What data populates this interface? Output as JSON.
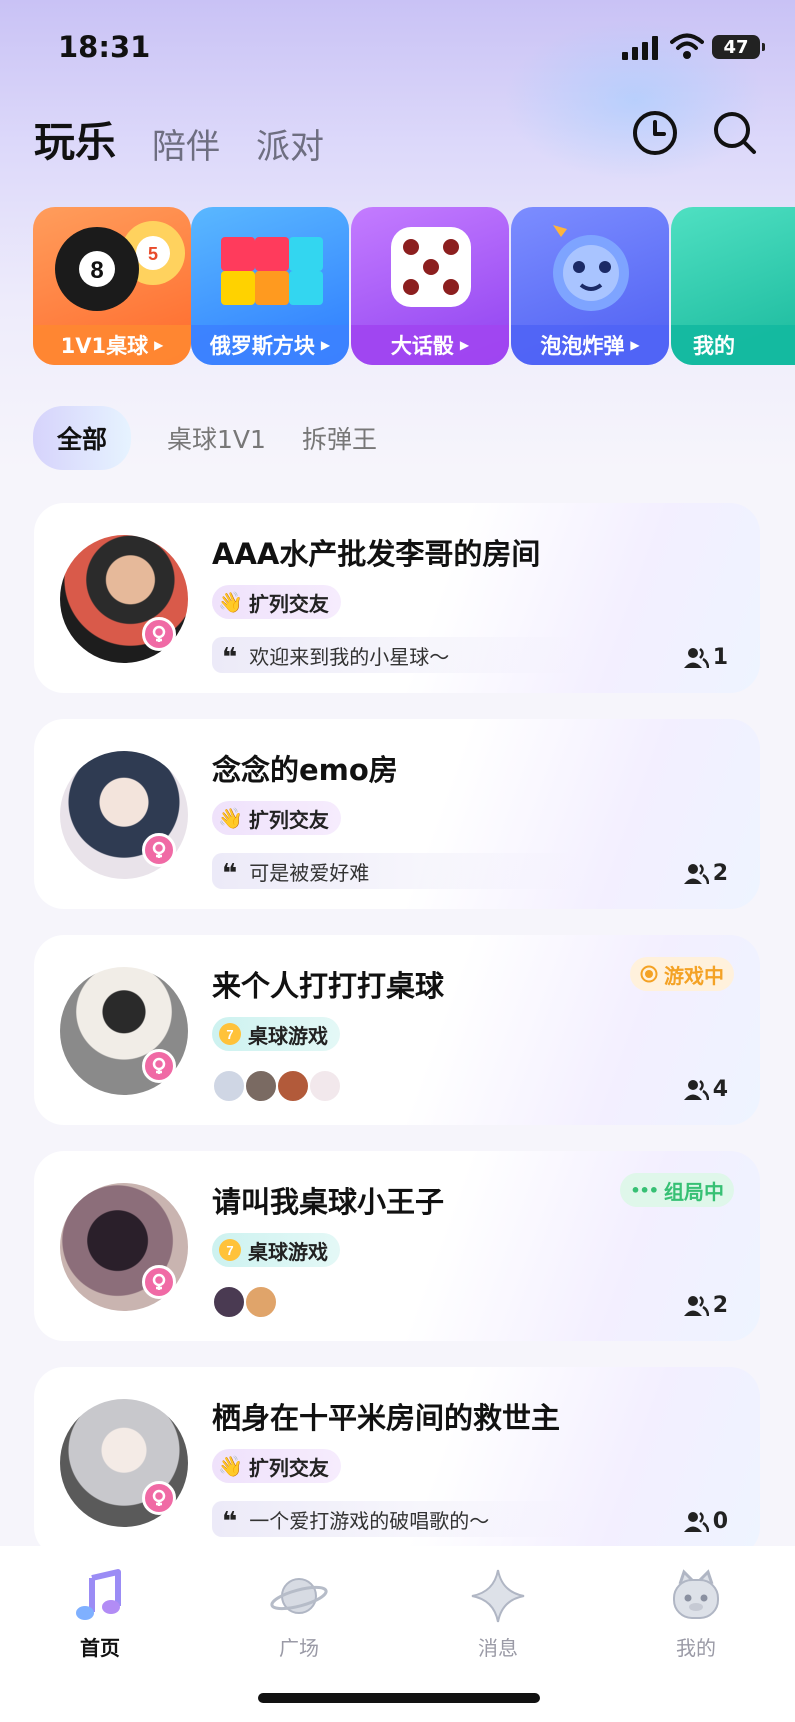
{
  "status_bar": {
    "time": "18:31",
    "battery": "47"
  },
  "nav": {
    "tabs": [
      "玩乐",
      "陪伴",
      "派对"
    ],
    "active_index": 0,
    "history_icon": "clock-icon",
    "search_icon": "search-icon"
  },
  "games": [
    {
      "label": "1V1桌球",
      "icon": "billiard-icon",
      "color": "#ff7a3c"
    },
    {
      "label": "俄罗斯方块",
      "icon": "tetris-icon",
      "color": "#2e8cff"
    },
    {
      "label": "大话骰",
      "icon": "dice-icon",
      "color": "#a556f4"
    },
    {
      "label": "泡泡炸弹",
      "icon": "bomb-icon",
      "color": "#5b74f7"
    },
    {
      "label": "我的",
      "icon": "game-icon",
      "color": "#1fc1a6"
    }
  ],
  "filters": [
    "全部",
    "桌球1V1",
    "拆弹王"
  ],
  "rooms": [
    {
      "title": "AAA水产批发李哥的房间",
      "tag": "扩列交友",
      "quote": "欢迎来到我的小星球～",
      "count": "1"
    },
    {
      "title": "念念的emo房",
      "tag": "扩列交友",
      "quote": "可是被爱好难",
      "count": "2"
    },
    {
      "title": "来个人打打打桌球",
      "tag": "桌球游戏",
      "status": "游戏中",
      "count": "4"
    },
    {
      "title": "请叫我桌球小王子",
      "tag": "桌球游戏",
      "status": "组局中",
      "count": "2"
    },
    {
      "title": "栖身在十平米房间的救世主",
      "tag": "扩列交友",
      "quote": "一个爱打游戏的破唱歌的～",
      "count": "0"
    }
  ],
  "quote_mark": "❝",
  "bottom_nav": [
    {
      "label": "首页",
      "icon": "music-note-icon"
    },
    {
      "label": "广场",
      "icon": "planet-icon"
    },
    {
      "label": "消息",
      "icon": "sparkle-icon"
    },
    {
      "label": "我的",
      "icon": "face-icon"
    }
  ],
  "colors": {
    "accent_purple": "#b9b2f2",
    "female": "#f06aa5",
    "playing": "#f4a225",
    "grouping": "#37c074"
  }
}
